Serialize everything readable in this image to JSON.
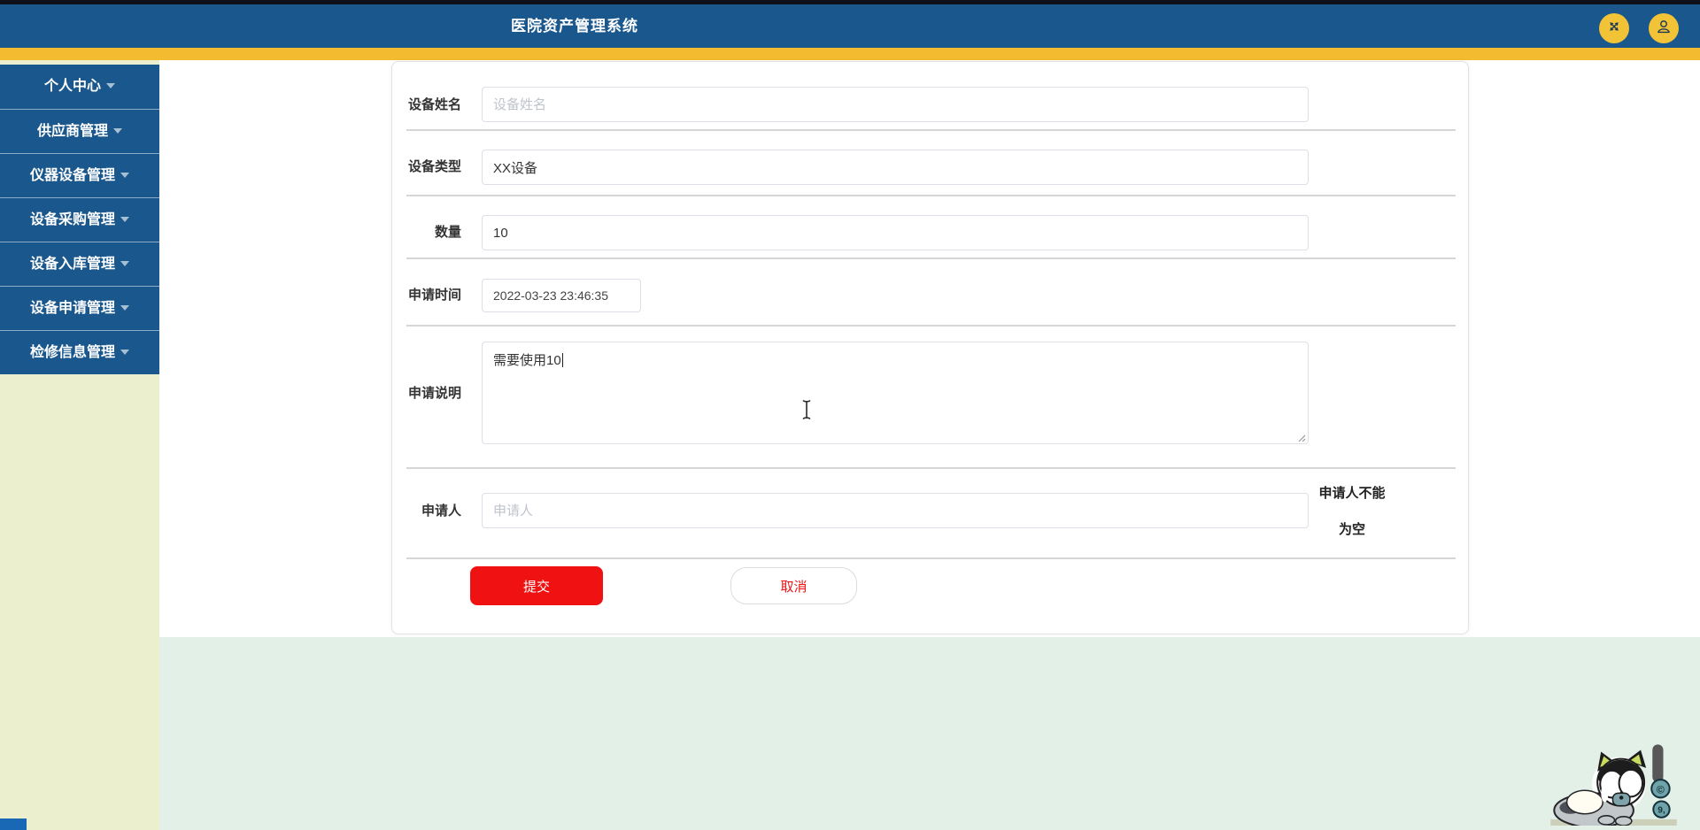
{
  "app": {
    "title": "医院资产管理系统"
  },
  "header": {
    "icons": [
      {
        "name": "fullscreen-icon"
      },
      {
        "name": "user-icon"
      }
    ],
    "accent_color": "#f2bb30",
    "bar_color": "#19578d"
  },
  "sidebar": {
    "bg_color": "#ecefcd",
    "items": [
      {
        "label": "个人中心"
      },
      {
        "label": "供应商管理"
      },
      {
        "label": "仪器设备管理"
      },
      {
        "label": "设备采购管理"
      },
      {
        "label": "设备入库管理"
      },
      {
        "label": "设备申请管理"
      },
      {
        "label": "检修信息管理"
      }
    ]
  },
  "form": {
    "fields": {
      "device_name": {
        "label": "设备姓名",
        "placeholder": "设备姓名",
        "value": ""
      },
      "device_type": {
        "label": "设备类型",
        "value": "XX设备"
      },
      "quantity": {
        "label": "数量",
        "value": "10"
      },
      "apply_time": {
        "label": "申请时间",
        "value": "2022-03-23 23:46:35"
      },
      "apply_note": {
        "label": "申请说明",
        "value": "需要使用10"
      },
      "applicant": {
        "label": "申请人",
        "placeholder": "申请人",
        "value": "",
        "error": "申请人不能为空"
      }
    },
    "buttons": {
      "submit": "提交",
      "cancel": "取消"
    }
  },
  "colors": {
    "submit_red": "#f01212",
    "footer_mint": "#e2f0e8",
    "header_blue": "#19578d",
    "stripe_yellow": "#f2bb30",
    "sidebar_cream": "#ecefcd"
  }
}
